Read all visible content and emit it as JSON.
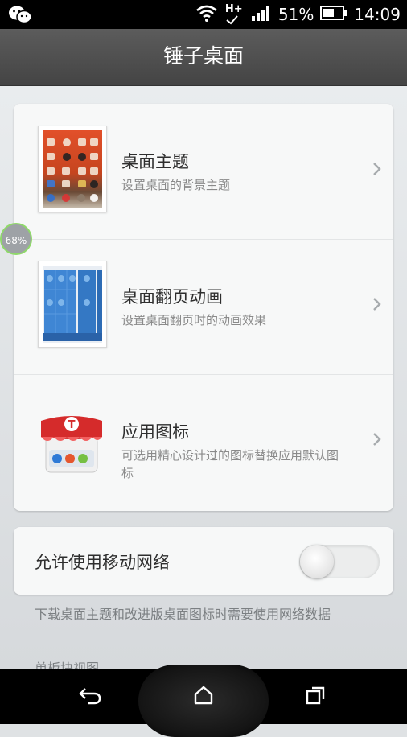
{
  "status_bar": {
    "network_type": "H+",
    "battery_percent": "51%",
    "time": "14:09"
  },
  "title": "锤子桌面",
  "settings": [
    {
      "title": "桌面主题",
      "subtitle": "设置桌面的背景主题",
      "icon": "desktop-theme-thumbnail"
    },
    {
      "title": "桌面翻页动画",
      "subtitle": "设置桌面翻页时的动画效果",
      "icon": "page-flip-thumbnail"
    },
    {
      "title": "应用图标",
      "subtitle": "可选用精心设计过的图标替换应用默认图标",
      "icon": "app-icon-store-thumbnail"
    }
  ],
  "network": {
    "label": "允许使用移动网络",
    "enabled": false,
    "description": "下载桌面主题和改进版桌面图标时需要使用网络数据"
  },
  "next_section": "单板块视图",
  "memory_indicator": "68%",
  "colors": {
    "accent_green": "#8fd96a",
    "titlebar": "#4e4e4e",
    "background": "#dfe2e4"
  }
}
